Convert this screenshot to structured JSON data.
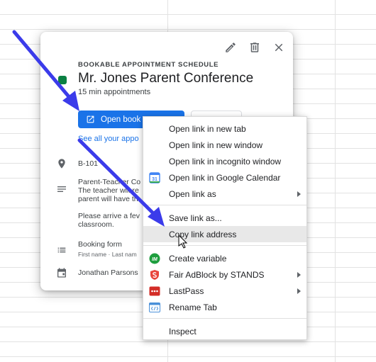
{
  "colors": {
    "accent": "#1a73e8",
    "calendar_green": "#0b8043",
    "annotation_arrow": "#3b3bea"
  },
  "card": {
    "section_label": "BOOKABLE APPOINTMENT SCHEDULE",
    "title": "Mr. Jones Parent Conference",
    "subtitle": "15 min appointments",
    "open_booking_label": "Open book",
    "see_all_label": "See all your appo",
    "location": "B-101",
    "description_line1": "Parent-Teacher Co",
    "description_line2": "The teacher will re",
    "description_line3": "parent will have th",
    "description_line4": "Please arrive a fev",
    "description_line5": "classroom.",
    "booking_form_label": "Booking form",
    "booking_form_fields": "First name · Last nam",
    "owner": "Jonathan Parsons",
    "icons": {
      "edit": "pencil-icon",
      "delete": "trash-icon",
      "close": "close-icon",
      "location": "location-pin-icon",
      "description": "notes-icon",
      "form": "list-icon",
      "calendar": "calendar-icon"
    }
  },
  "context_menu": {
    "items": [
      {
        "label": "Open link in new tab"
      },
      {
        "label": "Open link in new window"
      },
      {
        "label": "Open link in incognito window"
      },
      {
        "label": "Open link in Google Calendar",
        "icon": "google-calendar-icon"
      },
      {
        "label": "Open link as"
      },
      {
        "label": "Save link as..."
      },
      {
        "label": "Copy link address"
      },
      {
        "label": "Create variable",
        "icon": "im-extension-icon"
      },
      {
        "label": "Fair AdBlock by STANDS",
        "icon": "stands-adblock-icon"
      },
      {
        "label": "LastPass",
        "icon": "lastpass-icon"
      },
      {
        "label": "Rename Tab",
        "icon": "rename-tab-icon"
      },
      {
        "label": "Inspect"
      }
    ],
    "calendar_icon_text": "31",
    "im_icon_text": "IM"
  }
}
